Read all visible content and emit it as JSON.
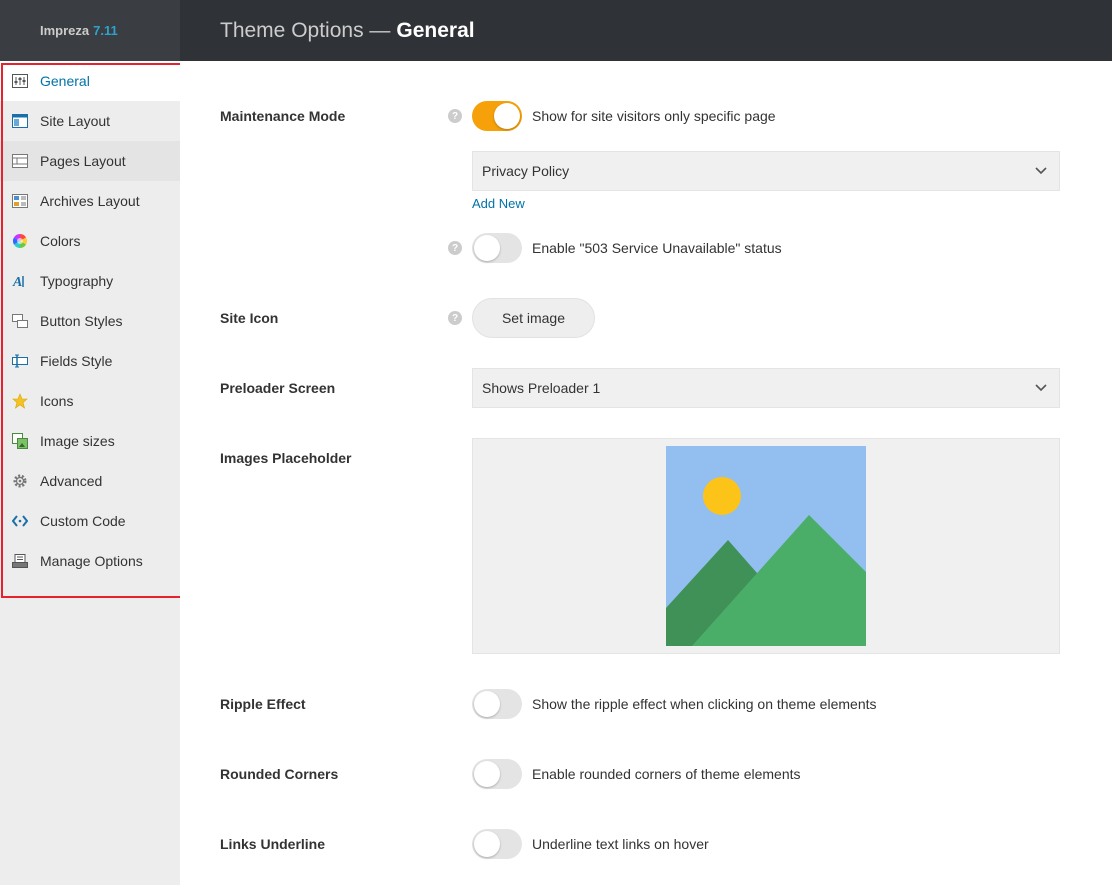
{
  "brand": {
    "name": "Impreza",
    "version": "7.11"
  },
  "header": {
    "title_prefix": "Theme Options —",
    "title_page": "General"
  },
  "sidebar": {
    "items": [
      {
        "label": "General",
        "icon": "sliders-icon"
      },
      {
        "label": "Site Layout",
        "icon": "site-layout-icon"
      },
      {
        "label": "Pages Layout",
        "icon": "pages-layout-icon"
      },
      {
        "label": "Archives Layout",
        "icon": "archives-layout-icon"
      },
      {
        "label": "Colors",
        "icon": "color-wheel-icon"
      },
      {
        "label": "Typography",
        "icon": "typography-icon"
      },
      {
        "label": "Button Styles",
        "icon": "button-styles-icon"
      },
      {
        "label": "Fields Style",
        "icon": "fields-style-icon"
      },
      {
        "label": "Icons",
        "icon": "star-icon"
      },
      {
        "label": "Image sizes",
        "icon": "image-sizes-icon"
      },
      {
        "label": "Advanced",
        "icon": "gear-icon"
      },
      {
        "label": "Custom Code",
        "icon": "code-icon"
      },
      {
        "label": "Manage Options",
        "icon": "manage-options-icon"
      }
    ]
  },
  "main": {
    "maintenance": {
      "label": "Maintenance Mode",
      "toggle_text": "Show for site visitors only specific page",
      "toggle_on": true,
      "page_select": "Privacy Policy",
      "add_new": "Add New",
      "status_text": "Enable \"503 Service Unavailable\" status",
      "status_on": false
    },
    "site_icon": {
      "label": "Site Icon",
      "button": "Set image"
    },
    "preloader": {
      "label": "Preloader Screen",
      "value": "Shows Preloader 1"
    },
    "images_placeholder": {
      "label": "Images Placeholder"
    },
    "ripple": {
      "label": "Ripple Effect",
      "text": "Show the ripple effect when clicking on theme elements",
      "on": false
    },
    "rounded": {
      "label": "Rounded Corners",
      "text": "Enable rounded corners of theme elements",
      "on": false
    },
    "links": {
      "label": "Links Underline",
      "text": "Underline text links on hover",
      "on": false
    }
  },
  "colors": {
    "accent": "#f6a00a",
    "link": "#0073aa",
    "highlight": "#e8212e"
  }
}
